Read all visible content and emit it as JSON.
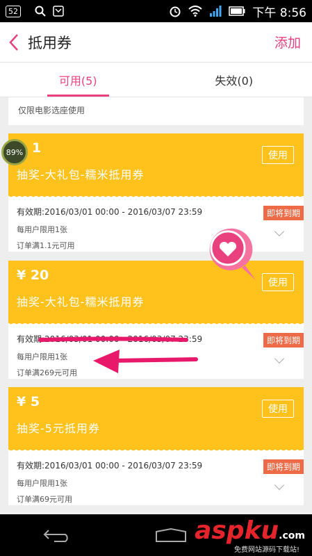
{
  "status_bar": {
    "badge": "52",
    "time": "下午 8:56"
  },
  "header": {
    "back_icon": "chevron-left-icon",
    "title": "抵用券",
    "add_label": "添加"
  },
  "tabs": [
    {
      "label": "可用(5)",
      "active": true
    },
    {
      "label": "失效(0)",
      "active": false
    }
  ],
  "partial_card": {
    "text": "仅限电影选座使用"
  },
  "coupons": [
    {
      "amount": "1",
      "name": "抽奖-大礼包-糯米抵用券",
      "use_label": "使用",
      "validity_label": "有效期:",
      "validity": "2016/03/01 00:00 - 2016/03/07 23:59",
      "limit": "每用户限用1张",
      "min_order": "订单满1.1元可用",
      "badge": "即将到期"
    },
    {
      "amount": "¥ 20",
      "name": "抽奖-大礼包-糯米抵用券",
      "use_label": "使用",
      "validity_label": "有效期:",
      "validity": "2016/03/01 00:00 - 2016/03/07 23:59",
      "limit": "每用户限用1张",
      "min_order": "订单满269元可用",
      "badge": "即将到期"
    },
    {
      "amount": "¥ 5",
      "name": "抽奖-5元抵用券",
      "use_label": "使用",
      "validity_label": "有效期:",
      "validity": "2016/03/01 00:00 - 2016/03/07 23:59",
      "limit": "每用户限用1张",
      "min_order": "订单满69元可用",
      "badge": "即将到期"
    }
  ],
  "overlay": {
    "progress_text": "89%",
    "watermark": "aspku",
    "watermark_suffix": ".com",
    "watermark_sub": "免费网站源码下载站!"
  },
  "colors": {
    "accent": "#e8417d",
    "coupon_yellow": "#ffc21d",
    "expiring_badge": "#ee6b48",
    "watermark_red": "#e5252b"
  }
}
